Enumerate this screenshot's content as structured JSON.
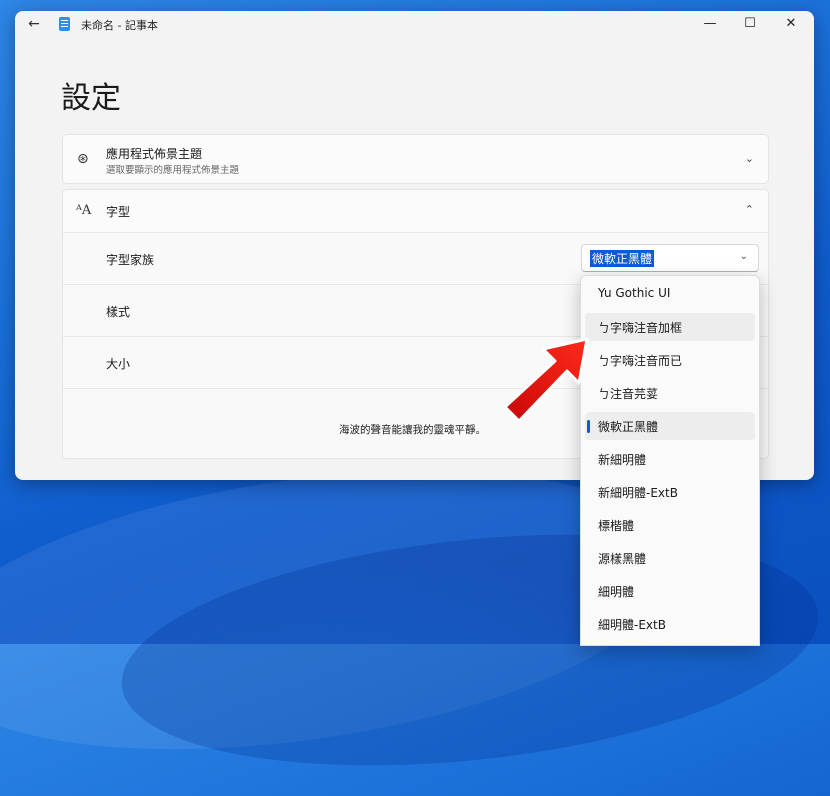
{
  "window": {
    "title": "未命名 - 記事本",
    "back_icon": "back-arrow-icon",
    "minimize_icon": "minimize-icon",
    "maximize_icon": "maximize-icon",
    "close_icon": "close-icon"
  },
  "page": {
    "title": "設定"
  },
  "theme_card": {
    "title": "應用程式佈景主題",
    "subtitle": "選取要顯示的應用程式佈景主題",
    "icon": "palette-icon"
  },
  "font_card": {
    "title": "字型",
    "icon": "font-icon",
    "family_label": "字型家族",
    "family_value": "微軟正黑體",
    "style_label": "樣式",
    "size_label": "大小",
    "sample_text": "海波的聲音能讓我的靈魂平靜。"
  },
  "font_options": [
    {
      "label": "Yu Gothic UI"
    },
    {
      "label": "ㄅ字嗨注音加框"
    },
    {
      "label": "ㄅ字嗨注音而已"
    },
    {
      "label": "ㄅ注音芫荽"
    },
    {
      "label": "微軟正黑體"
    },
    {
      "label": "新細明體"
    },
    {
      "label": "新細明體-ExtB"
    },
    {
      "label": "標楷體"
    },
    {
      "label": "源樣黑體"
    },
    {
      "label": "細明體"
    },
    {
      "label": "細明體-ExtB"
    }
  ],
  "colors": {
    "accent": "#0a5bd6",
    "arrow": "#e01010"
  }
}
